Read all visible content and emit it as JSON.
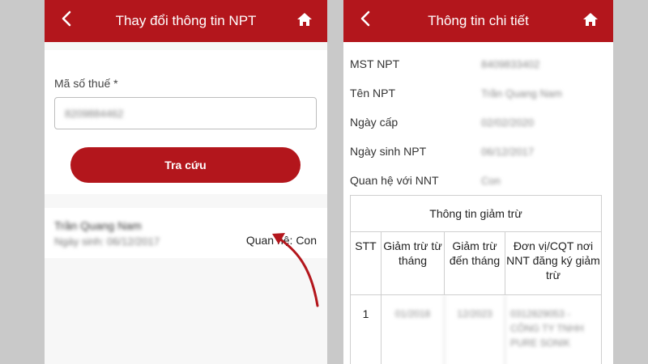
{
  "left": {
    "title": "Thay đổi thông tin NPT",
    "field_label": "Mã số thuế *",
    "field_value": "8209884462",
    "search_label": "Tra cứu",
    "result": {
      "name": "Trần Quang Nam",
      "dob": "Ngày sinh: 06/12/2017",
      "relation": "Quan hệ: Con"
    }
  },
  "right": {
    "title": "Thông tin chi tiết",
    "rows": [
      {
        "label": "MST NPT",
        "value": "8409833402"
      },
      {
        "label": "Tên NPT",
        "value": "Trần Quang Nam"
      },
      {
        "label": "Ngày cấp",
        "value": "02/02/2020"
      },
      {
        "label": "Ngày sinh NPT",
        "value": "06/12/2017"
      },
      {
        "label": "Quan hệ với NNT",
        "value": "Con"
      }
    ],
    "table": {
      "heading": "Thông tin giảm trừ",
      "columns": [
        "STT",
        "Giảm trừ từ tháng",
        "Giảm trừ đến tháng",
        "Đơn vị/CQT nơi NNT đăng ký giảm trừ"
      ],
      "rows": [
        [
          "1",
          "01/2018",
          "12/2023",
          "0312829053 - CÔNG TY TNHH PURE SONIK"
        ]
      ]
    }
  },
  "icons": {
    "back": "chevron-left-icon",
    "home": "home-icon"
  },
  "colors": {
    "brand_red": "#b3161c",
    "background": "#c9c9c9",
    "arrow": "#b3161c"
  }
}
